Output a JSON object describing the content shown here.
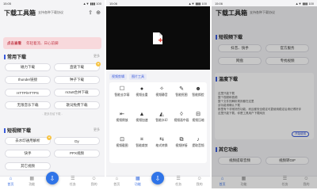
{
  "status": {
    "time": "15:05",
    "time2": "15:06",
    "signal": "▲▼ ▮▮▮ 100"
  },
  "app": {
    "title": "下载工具箱",
    "subtitle": "支持各种下载协议"
  },
  "notice": {
    "label": "点击查看",
    "text": "年轻着流、日心前脚"
  },
  "sections": {
    "common": "常用下载",
    "video": "短视频下载",
    "more": "更多"
  },
  "common_buttons": [
    "磁力下载",
    "直链下载",
    "thunder链接",
    "种子下载",
    "HTTP/HTTPS",
    "m3u8合并下载",
    "无限音乐下载",
    "歌词免费下载"
  ],
  "divider": "- 更多总给下载 -",
  "video_buttons": [
    "去水印通用解析",
    "Dy",
    "快手",
    "PPX视频",
    "其它视频"
  ],
  "nav": {
    "home": "首页",
    "tools": "功能",
    "download": "",
    "tasks": "任务",
    "mine": "我的"
  },
  "panel2": {
    "tabs": [
      "视频剪辑",
      "图片工具"
    ],
    "tools": [
      "智能去字幕",
      "视频去重",
      "视频静音",
      "智能抠图",
      "智能换脸",
      "视频倒放",
      "视频加速",
      "智能水印",
      "视频画中画",
      "视频压缩",
      "视频截图",
      "智能裁剪",
      "格式转换",
      "视频拼接",
      "提取音频",
      "提取字幕",
      "视频特效",
      "画中画"
    ]
  },
  "panel3": {
    "title": "下载工具箱",
    "subtitle": "支持各种下载协议",
    "video_title": "短视频下载",
    "video_buttons": [
      "抖音、快手",
      "官方服务",
      "网盘",
      "专找视频"
    ],
    "tip_title": "温度下载",
    "info": [
      "这里只能下载",
      "整个视频和音频",
      "整个文件的解析规则都在这里",
      "该功能请确认下载",
      "那里有个非常好的功能，而且都安全稳定可靠使用稳定后请记得好评",
      "这里只能下载，你是工具用户下载网页"
    ],
    "info_btn": "开始使用",
    "func_title": "其它功能",
    "func_buttons": [
      "视频提取音频",
      "视频转GIF"
    ]
  }
}
